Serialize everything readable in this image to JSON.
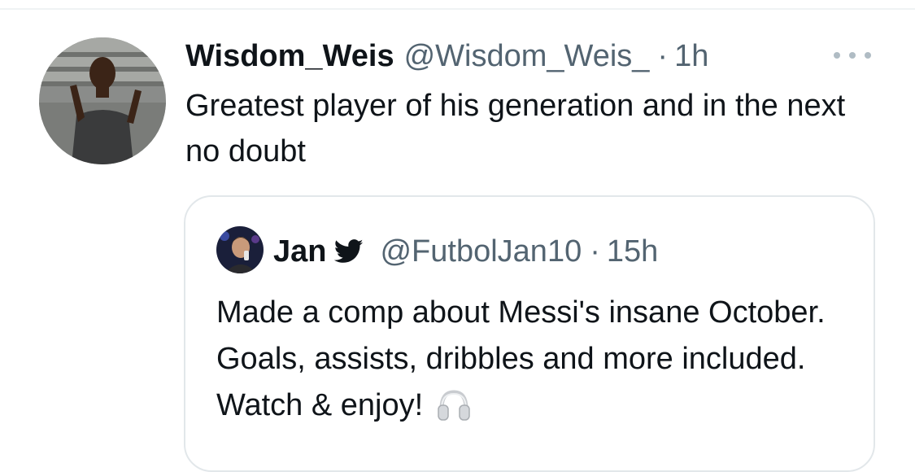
{
  "tweet": {
    "display_name": "Wisdom_Weis",
    "handle": "@Wisdom_Weis_",
    "separator": "·",
    "time": "1h",
    "text": "Greatest player of his generation and in the next no doubt",
    "more_icon": "more-horizontal-icon"
  },
  "quoted_tweet": {
    "display_name": "Jan",
    "verified_icon": "twitter-bird-icon",
    "handle": "@FutbolJan10",
    "separator": "·",
    "time": "15h",
    "text": "Made a comp about Messi's insane October. Goals, assists, dribbles and more included. Watch & enjoy!",
    "emoji_icon": "headphones-icon"
  },
  "colors": {
    "text": "#0f1419",
    "secondary": "#536471",
    "border": "#e2e7ea",
    "verified_icon": "#0f1419"
  }
}
